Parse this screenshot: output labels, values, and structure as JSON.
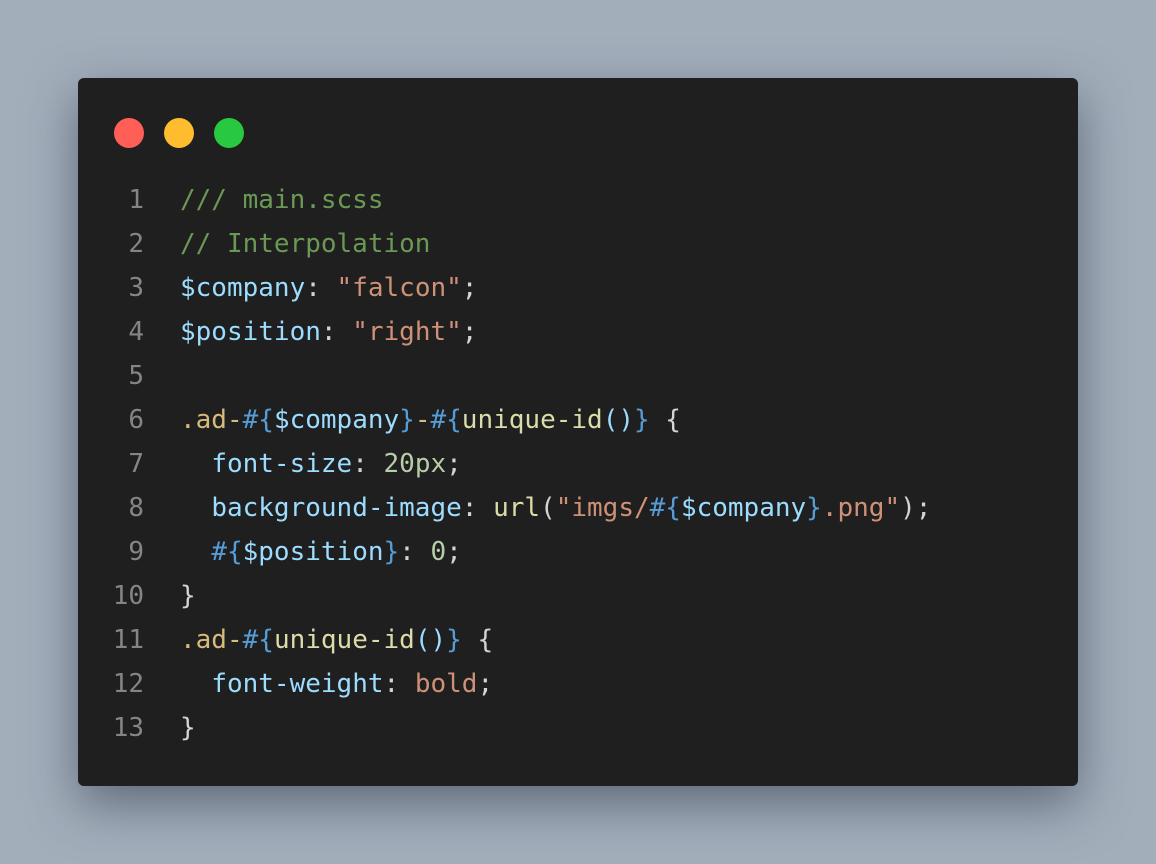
{
  "window": {
    "controls": [
      {
        "name": "close",
        "color": "#ff5f57"
      },
      {
        "name": "minimize",
        "color": "#febc2e"
      },
      {
        "name": "maximize",
        "color": "#28c840"
      }
    ]
  },
  "colors": {
    "comment": "#6a9955",
    "variable": "#9cdcfe",
    "punct": "#d4d4d4",
    "string": "#ce9178",
    "selector": "#d7ba7d",
    "brace": "#569cd6",
    "function": "#dcdcaa",
    "number": "#b5cea8"
  },
  "code": {
    "lines": [
      {
        "num": "1",
        "tokens": [
          {
            "t": "/// main.scss",
            "c": "comment"
          }
        ]
      },
      {
        "num": "2",
        "tokens": [
          {
            "t": "// Interpolation",
            "c": "comment"
          }
        ]
      },
      {
        "num": "3",
        "tokens": [
          {
            "t": "$company",
            "c": "variable"
          },
          {
            "t": ": ",
            "c": "punct"
          },
          {
            "t": "\"falcon\"",
            "c": "string"
          },
          {
            "t": ";",
            "c": "punct"
          }
        ]
      },
      {
        "num": "4",
        "tokens": [
          {
            "t": "$position",
            "c": "variable"
          },
          {
            "t": ": ",
            "c": "punct"
          },
          {
            "t": "\"right\"",
            "c": "string"
          },
          {
            "t": ";",
            "c": "punct"
          }
        ]
      },
      {
        "num": "5",
        "tokens": []
      },
      {
        "num": "6",
        "tokens": [
          {
            "t": ".ad-",
            "c": "selector"
          },
          {
            "t": "#{",
            "c": "brace"
          },
          {
            "t": "$company",
            "c": "variable"
          },
          {
            "t": "}",
            "c": "brace"
          },
          {
            "t": "-",
            "c": "selector"
          },
          {
            "t": "#{",
            "c": "brace"
          },
          {
            "t": "unique-id",
            "c": "function"
          },
          {
            "t": "()",
            "c": "variable"
          },
          {
            "t": "}",
            "c": "brace"
          },
          {
            "t": " {",
            "c": "punct"
          }
        ]
      },
      {
        "num": "7",
        "tokens": [
          {
            "t": "  ",
            "c": "punct"
          },
          {
            "t": "font-size",
            "c": "variable"
          },
          {
            "t": ": ",
            "c": "punct"
          },
          {
            "t": "20px",
            "c": "number"
          },
          {
            "t": ";",
            "c": "punct"
          }
        ]
      },
      {
        "num": "8",
        "tokens": [
          {
            "t": "  ",
            "c": "punct"
          },
          {
            "t": "background-image",
            "c": "variable"
          },
          {
            "t": ": ",
            "c": "punct"
          },
          {
            "t": "url",
            "c": "function"
          },
          {
            "t": "(",
            "c": "punct"
          },
          {
            "t": "\"imgs/",
            "c": "string"
          },
          {
            "t": "#{",
            "c": "brace"
          },
          {
            "t": "$company",
            "c": "variable"
          },
          {
            "t": "}",
            "c": "brace"
          },
          {
            "t": ".png\"",
            "c": "string"
          },
          {
            "t": ");",
            "c": "punct"
          }
        ]
      },
      {
        "num": "9",
        "tokens": [
          {
            "t": "  ",
            "c": "punct"
          },
          {
            "t": "#{",
            "c": "brace"
          },
          {
            "t": "$position",
            "c": "variable"
          },
          {
            "t": "}",
            "c": "brace"
          },
          {
            "t": ": ",
            "c": "punct"
          },
          {
            "t": "0",
            "c": "number"
          },
          {
            "t": ";",
            "c": "punct"
          }
        ]
      },
      {
        "num": "10",
        "tokens": [
          {
            "t": "}",
            "c": "punct"
          }
        ]
      },
      {
        "num": "11",
        "tokens": [
          {
            "t": ".ad-",
            "c": "selector"
          },
          {
            "t": "#{",
            "c": "brace"
          },
          {
            "t": "unique-id",
            "c": "function"
          },
          {
            "t": "()",
            "c": "variable"
          },
          {
            "t": "}",
            "c": "brace"
          },
          {
            "t": " {",
            "c": "punct"
          }
        ]
      },
      {
        "num": "12",
        "tokens": [
          {
            "t": "  ",
            "c": "punct"
          },
          {
            "t": "font-weight",
            "c": "variable"
          },
          {
            "t": ": ",
            "c": "punct"
          },
          {
            "t": "bold",
            "c": "string"
          },
          {
            "t": ";",
            "c": "punct"
          }
        ]
      },
      {
        "num": "13",
        "tokens": [
          {
            "t": "}",
            "c": "punct"
          }
        ]
      }
    ]
  }
}
